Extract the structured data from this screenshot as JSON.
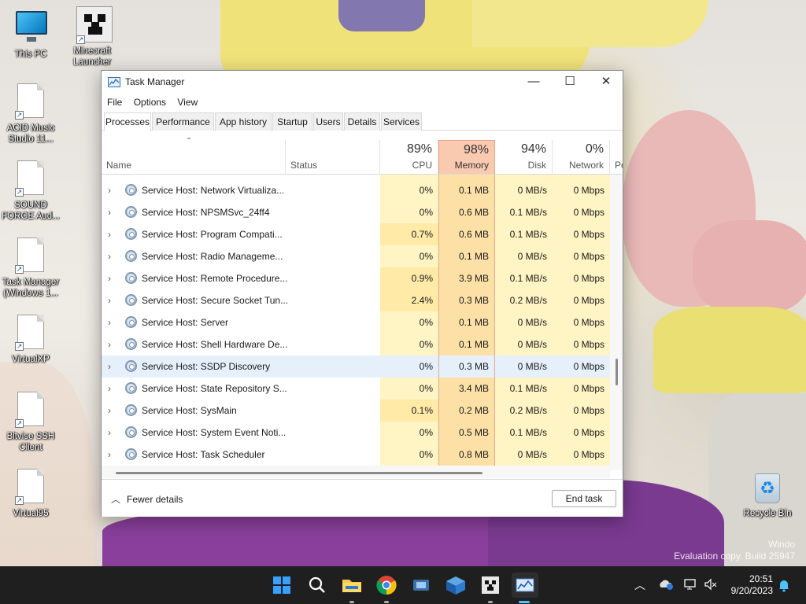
{
  "desktop": {
    "icons": [
      {
        "label": "This PC",
        "type": "monitor"
      },
      {
        "label": "Minecraft Launcher",
        "type": "creeper"
      },
      {
        "label": "ACID Music Studio 11...",
        "type": "file"
      },
      {
        "label": "SOUND FORGE Aud...",
        "type": "file"
      },
      {
        "label": "Task Manager (Windows 1...",
        "type": "file"
      },
      {
        "label": "VirtualXP",
        "type": "file"
      },
      {
        "label": "Bitvise SSH Client",
        "type": "file"
      },
      {
        "label": "Virtual95",
        "type": "file"
      },
      {
        "label": "Recycle Bin",
        "type": "recycle"
      }
    ],
    "watermark": {
      "line1": "Windo",
      "line2": "Evaluation copy. Build 25947"
    }
  },
  "window": {
    "title": "Task Manager",
    "controls": {
      "minimize": "—",
      "maximize": "☐",
      "close": "✕"
    },
    "menu": [
      "File",
      "Options",
      "View"
    ],
    "tabs": [
      "Processes",
      "Performance",
      "App history",
      "Startup",
      "Users",
      "Details",
      "Services"
    ],
    "active_tab": "Processes",
    "columns": {
      "name": "Name",
      "status": "Status",
      "cpu": {
        "pct": "89%",
        "label": "CPU"
      },
      "memory": {
        "pct": "98%",
        "label": "Memory"
      },
      "disk": {
        "pct": "94%",
        "label": "Disk"
      },
      "network": {
        "pct": "0%",
        "label": "Network"
      },
      "power_partial": "Po"
    },
    "rows": [
      {
        "name": "Service Host: Network Virtualiza...",
        "cpu": "0%",
        "memory": "0.1 MB",
        "disk": "0 MB/s",
        "network": "0 Mbps"
      },
      {
        "name": "Service Host: NPSMSvc_24ff4",
        "cpu": "0%",
        "memory": "0.6 MB",
        "disk": "0.1 MB/s",
        "network": "0 Mbps"
      },
      {
        "name": "Service Host: Program Compati...",
        "cpu": "0.7%",
        "memory": "0.6 MB",
        "disk": "0.1 MB/s",
        "network": "0 Mbps"
      },
      {
        "name": "Service Host: Radio Manageme...",
        "cpu": "0%",
        "memory": "0.1 MB",
        "disk": "0 MB/s",
        "network": "0 Mbps"
      },
      {
        "name": "Service Host: Remote Procedure...",
        "cpu": "0.9%",
        "memory": "3.9 MB",
        "disk": "0.1 MB/s",
        "network": "0 Mbps"
      },
      {
        "name": "Service Host: Secure Socket Tun...",
        "cpu": "2.4%",
        "memory": "0.3 MB",
        "disk": "0.2 MB/s",
        "network": "0 Mbps"
      },
      {
        "name": "Service Host: Server",
        "cpu": "0%",
        "memory": "0.1 MB",
        "disk": "0 MB/s",
        "network": "0 Mbps"
      },
      {
        "name": "Service Host: Shell Hardware De...",
        "cpu": "0%",
        "memory": "0.1 MB",
        "disk": "0 MB/s",
        "network": "0 Mbps"
      },
      {
        "name": "Service Host: SSDP Discovery",
        "cpu": "0%",
        "memory": "0.3 MB",
        "disk": "0 MB/s",
        "network": "0 Mbps"
      },
      {
        "name": "Service Host: State Repository S...",
        "cpu": "0%",
        "memory": "3.4 MB",
        "disk": "0.1 MB/s",
        "network": "0 Mbps"
      },
      {
        "name": "Service Host: SysMain",
        "cpu": "0.1%",
        "memory": "0.2 MB",
        "disk": "0.2 MB/s",
        "network": "0 Mbps"
      },
      {
        "name": "Service Host: System Event Noti...",
        "cpu": "0%",
        "memory": "0.5 MB",
        "disk": "0.1 MB/s",
        "network": "0 Mbps"
      },
      {
        "name": "Service Host: Task Scheduler",
        "cpu": "0%",
        "memory": "0.8 MB",
        "disk": "0 MB/s",
        "network": "0 Mbps"
      }
    ],
    "highlighted_row": 8,
    "footer": {
      "fewer_details": "Fewer details",
      "end_task": "End task"
    },
    "colors": {
      "cpu_light": "#fff4c4",
      "cpu_medium": "#ffeaa8",
      "memory_header": "#f9c9b0",
      "memory_cells": "#fde0a6",
      "disk_cells": "#fff4c4",
      "highlight": "#e5f0fb"
    }
  },
  "taskbar": {
    "apps": [
      "start-icon",
      "search-icon",
      "file-explorer-icon",
      "chrome-icon",
      "snipping-tool-icon",
      "virtualbox-icon",
      "minecraft-icon",
      "task-manager-icon"
    ],
    "time": "20:51",
    "date": "9/20/2023",
    "tray": [
      "chevron-up-icon",
      "onedrive-icon",
      "network-icon",
      "volume-muted-icon",
      "notification-icon"
    ]
  }
}
